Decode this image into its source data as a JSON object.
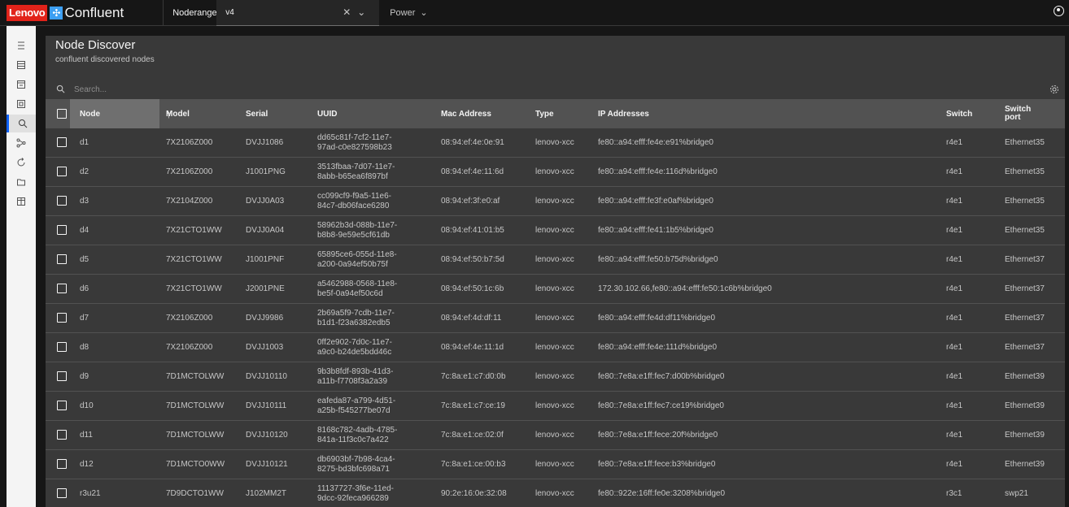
{
  "header": {
    "brand_logo": "Lenovo",
    "brand_name": "Confluent",
    "noderange_label": "Noderange",
    "noderange_value": "v4",
    "power_label": "Power"
  },
  "sidebar": {
    "items": [
      {
        "icon": "list-icon"
      },
      {
        "icon": "table-icon"
      },
      {
        "icon": "window-icon"
      },
      {
        "icon": "chip-icon"
      },
      {
        "icon": "discover-icon",
        "active": true
      },
      {
        "icon": "network-icon"
      },
      {
        "icon": "refresh-icon"
      },
      {
        "icon": "folder-icon"
      },
      {
        "icon": "grid-icon"
      }
    ]
  },
  "page": {
    "title": "Node Discover",
    "subtitle": "confluent discovered nodes"
  },
  "search": {
    "placeholder": "Search..."
  },
  "table": {
    "columns": {
      "node": "Node",
      "model": "Model",
      "serial": "Serial",
      "uuid": "UUID",
      "mac": "Mac Address",
      "type": "Type",
      "ip": "IP Addresses",
      "switch": "Switch",
      "switchport_1": "Switch",
      "switchport_2": "port"
    },
    "rows": [
      {
        "node": "d1",
        "model": "7X2106Z000",
        "serial": "DVJJ1086",
        "uuid_1": "dd65c81f-7cf2-11e7-",
        "uuid_2": "97ad-c0e827598b23",
        "mac": "08:94:ef:4e:0e:91",
        "type": "lenovo-xcc",
        "ip": "fe80::a94:efff:fe4e:e91%bridge0",
        "switch": "r4e1",
        "port": "Ethernet35"
      },
      {
        "node": "d2",
        "model": "7X2106Z000",
        "serial": "J1001PNG",
        "uuid_1": "3513fbaa-7d07-11e7-",
        "uuid_2": "8abb-b65ea6f897bf",
        "mac": "08:94:ef:4e:11:6d",
        "type": "lenovo-xcc",
        "ip": "fe80::a94:efff:fe4e:116d%bridge0",
        "switch": "r4e1",
        "port": "Ethernet35"
      },
      {
        "node": "d3",
        "model": "7X2104Z000",
        "serial": "DVJJ0A03",
        "uuid_1": "cc099cf9-f9a5-11e6-",
        "uuid_2": "84c7-db06face6280",
        "mac": "08:94:ef:3f:e0:af",
        "type": "lenovo-xcc",
        "ip": "fe80::a94:efff:fe3f:e0af%bridge0",
        "switch": "r4e1",
        "port": "Ethernet35"
      },
      {
        "node": "d4",
        "model": "7X21CTO1WW",
        "serial": "DVJJ0A04",
        "uuid_1": "58962b3d-088b-11e7-",
        "uuid_2": "b8b8-9e59e5cf61db",
        "mac": "08:94:ef:41:01:b5",
        "type": "lenovo-xcc",
        "ip": "fe80::a94:efff:fe41:1b5%bridge0",
        "switch": "r4e1",
        "port": "Ethernet35"
      },
      {
        "node": "d5",
        "model": "7X21CTO1WW",
        "serial": "J1001PNF",
        "uuid_1": "65895ce6-055d-11e8-",
        "uuid_2": "a200-0a94ef50b75f",
        "mac": "08:94:ef:50:b7:5d",
        "type": "lenovo-xcc",
        "ip": "fe80::a94:efff:fe50:b75d%bridge0",
        "switch": "r4e1",
        "port": "Ethernet37"
      },
      {
        "node": "d6",
        "model": "7X21CTO1WW",
        "serial": "J2001PNE",
        "uuid_1": "a5462988-0568-11e8-",
        "uuid_2": "be5f-0a94ef50c6d",
        "mac": "08:94:ef:50:1c:6b",
        "type": "lenovo-xcc",
        "ip": "172.30.102.66,fe80::a94:efff:fe50:1c6b%bridge0",
        "switch": "r4e1",
        "port": "Ethernet37"
      },
      {
        "node": "d7",
        "model": "7X2106Z000",
        "serial": "DVJJ9986",
        "uuid_1": "2b69a5f9-7cdb-11e7-",
        "uuid_2": "b1d1-f23a6382edb5",
        "mac": "08:94:ef:4d:df:11",
        "type": "lenovo-xcc",
        "ip": "fe80::a94:efff:fe4d:df11%bridge0",
        "switch": "r4e1",
        "port": "Ethernet37"
      },
      {
        "node": "d8",
        "model": "7X2106Z000",
        "serial": "DVJJ1003",
        "uuid_1": "0ff2e902-7d0c-11e7-",
        "uuid_2": "a9c0-b24de5bdd46c",
        "mac": "08:94:ef:4e:11:1d",
        "type": "lenovo-xcc",
        "ip": "fe80::a94:efff:fe4e:111d%bridge0",
        "switch": "r4e1",
        "port": "Ethernet37"
      },
      {
        "node": "d9",
        "model": "7D1MCTOLWW",
        "serial": "DVJJ10110",
        "uuid_1": "9b3b8fdf-893b-41d3-",
        "uuid_2": "a11b-f7708f3a2a39",
        "mac": "7c:8a:e1:c7:d0:0b",
        "type": "lenovo-xcc",
        "ip": "fe80::7e8a:e1ff:fec7:d00b%bridge0",
        "switch": "r4e1",
        "port": "Ethernet39"
      },
      {
        "node": "d10",
        "model": "7D1MCTOLWW",
        "serial": "DVJJ10111",
        "uuid_1": "eafeda87-a799-4d51-",
        "uuid_2": "a25b-f545277be07d",
        "mac": "7c:8a:e1:c7:ce:19",
        "type": "lenovo-xcc",
        "ip": "fe80::7e8a:e1ff:fec7:ce19%bridge0",
        "switch": "r4e1",
        "port": "Ethernet39"
      },
      {
        "node": "d11",
        "model": "7D1MCTOLWW",
        "serial": "DVJJ10120",
        "uuid_1": "8168c782-4adb-4785-",
        "uuid_2": "841a-11f3c0c7a422",
        "mac": "7c:8a:e1:ce:02:0f",
        "type": "lenovo-xcc",
        "ip": "fe80::7e8a:e1ff:fece:20f%bridge0",
        "switch": "r4e1",
        "port": "Ethernet39"
      },
      {
        "node": "d12",
        "model": "7D1MCTO0WW",
        "serial": "DVJJ10121",
        "uuid_1": "db6903bf-7b98-4ca4-",
        "uuid_2": "8275-bd3bfc698a71",
        "mac": "7c:8a:e1:ce:00:b3",
        "type": "lenovo-xcc",
        "ip": "fe80::7e8a:e1ff:fece:b3%bridge0",
        "switch": "r4e1",
        "port": "Ethernet39"
      },
      {
        "node": "r3u21",
        "model": "7D9DCTO1WW",
        "serial": "J102MM2T",
        "uuid_1": "11137727-3f6e-11ed-",
        "uuid_2": "9dcc-92feca966289",
        "mac": "90:2e:16:0e:32:08",
        "type": "lenovo-xcc",
        "ip": "fe80::922e:16ff:fe0e:3208%bridge0",
        "switch": "r3c1",
        "port": "swp21"
      }
    ]
  },
  "colors": {
    "brand_red": "#e2231a",
    "brand_blue": "#3d9ff2",
    "active_nav": "#0f62fe"
  }
}
